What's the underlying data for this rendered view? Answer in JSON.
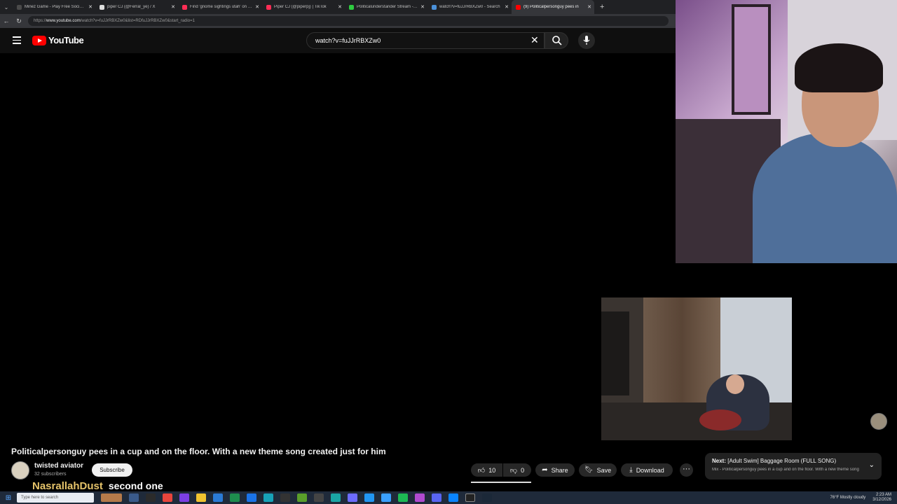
{
  "browser": {
    "tabs": [
      {
        "title": "Minez Game - Play Free Social Ca",
        "favicon_color": "#4a4a4a",
        "active": false
      },
      {
        "title": "piper CJ (@Ferral_ye) / X",
        "favicon_color": "#dddddd",
        "active": false
      },
      {
        "title": "Find 'gnome sightings utah' on TikT",
        "favicon_color": "#ff2d55",
        "active": false
      },
      {
        "title": "Piper CJ (@piperpj) | TikTok",
        "favicon_color": "#ff2d55",
        "active": false
      },
      {
        "title": "Politicalunderstander Stream - We",
        "favicon_color": "#2ecc40",
        "active": false
      },
      {
        "title": "watch?v=fuJJrRBXZw0 - Search",
        "favicon_color": "#4a90d9",
        "active": false
      },
      {
        "title": "(9) Politicalpersonguy pees in",
        "favicon_color": "#ff0000",
        "active": true
      }
    ],
    "url_prefix": "https://",
    "url_host": "www.youtube.com",
    "url_path": "/watch?v=fuJJrRBXZw0&list=RDfuJJrRBXZw0&start_radio=1"
  },
  "youtube": {
    "logo_text": "YouTube",
    "search_value": "watch?v=fuJJrRBXZw0",
    "video_title": "Politicalpersonguy pees in a cup and on the floor. With a new theme song created just for him",
    "channel_name": "twisted aviator",
    "subscribers": "32 subscribers",
    "subscribe_label": "Subscribe",
    "likes": "10",
    "dislikes": "0",
    "share_label": "Share",
    "save_label": "Save",
    "download_label": "Download",
    "more_label": "···",
    "next_label": "Next:",
    "next_title": "[Adult Swim] Baggage Room (FULL SONG)",
    "next_sub": "Mix - Politicalpersonguy pees in a cup and on the floor. With a new theme song"
  },
  "chat": {
    "user": "NasrallahDust",
    "message": "second one"
  },
  "taskbar": {
    "search_placeholder": "Type here to search",
    "weather": "76°F  Mostly cloudy",
    "time": "2:23 AM",
    "date": "3/12/2026"
  },
  "colors": {
    "yt_red": "#ff0000",
    "background": "#0f0f0f",
    "chat_user": "#e5c36a"
  },
  "icons": [
    "menu-icon",
    "search-icon",
    "mic-icon",
    "close-icon",
    "like-icon",
    "dislike-icon",
    "share-icon",
    "save-icon",
    "download-icon",
    "chevron-down-icon"
  ]
}
